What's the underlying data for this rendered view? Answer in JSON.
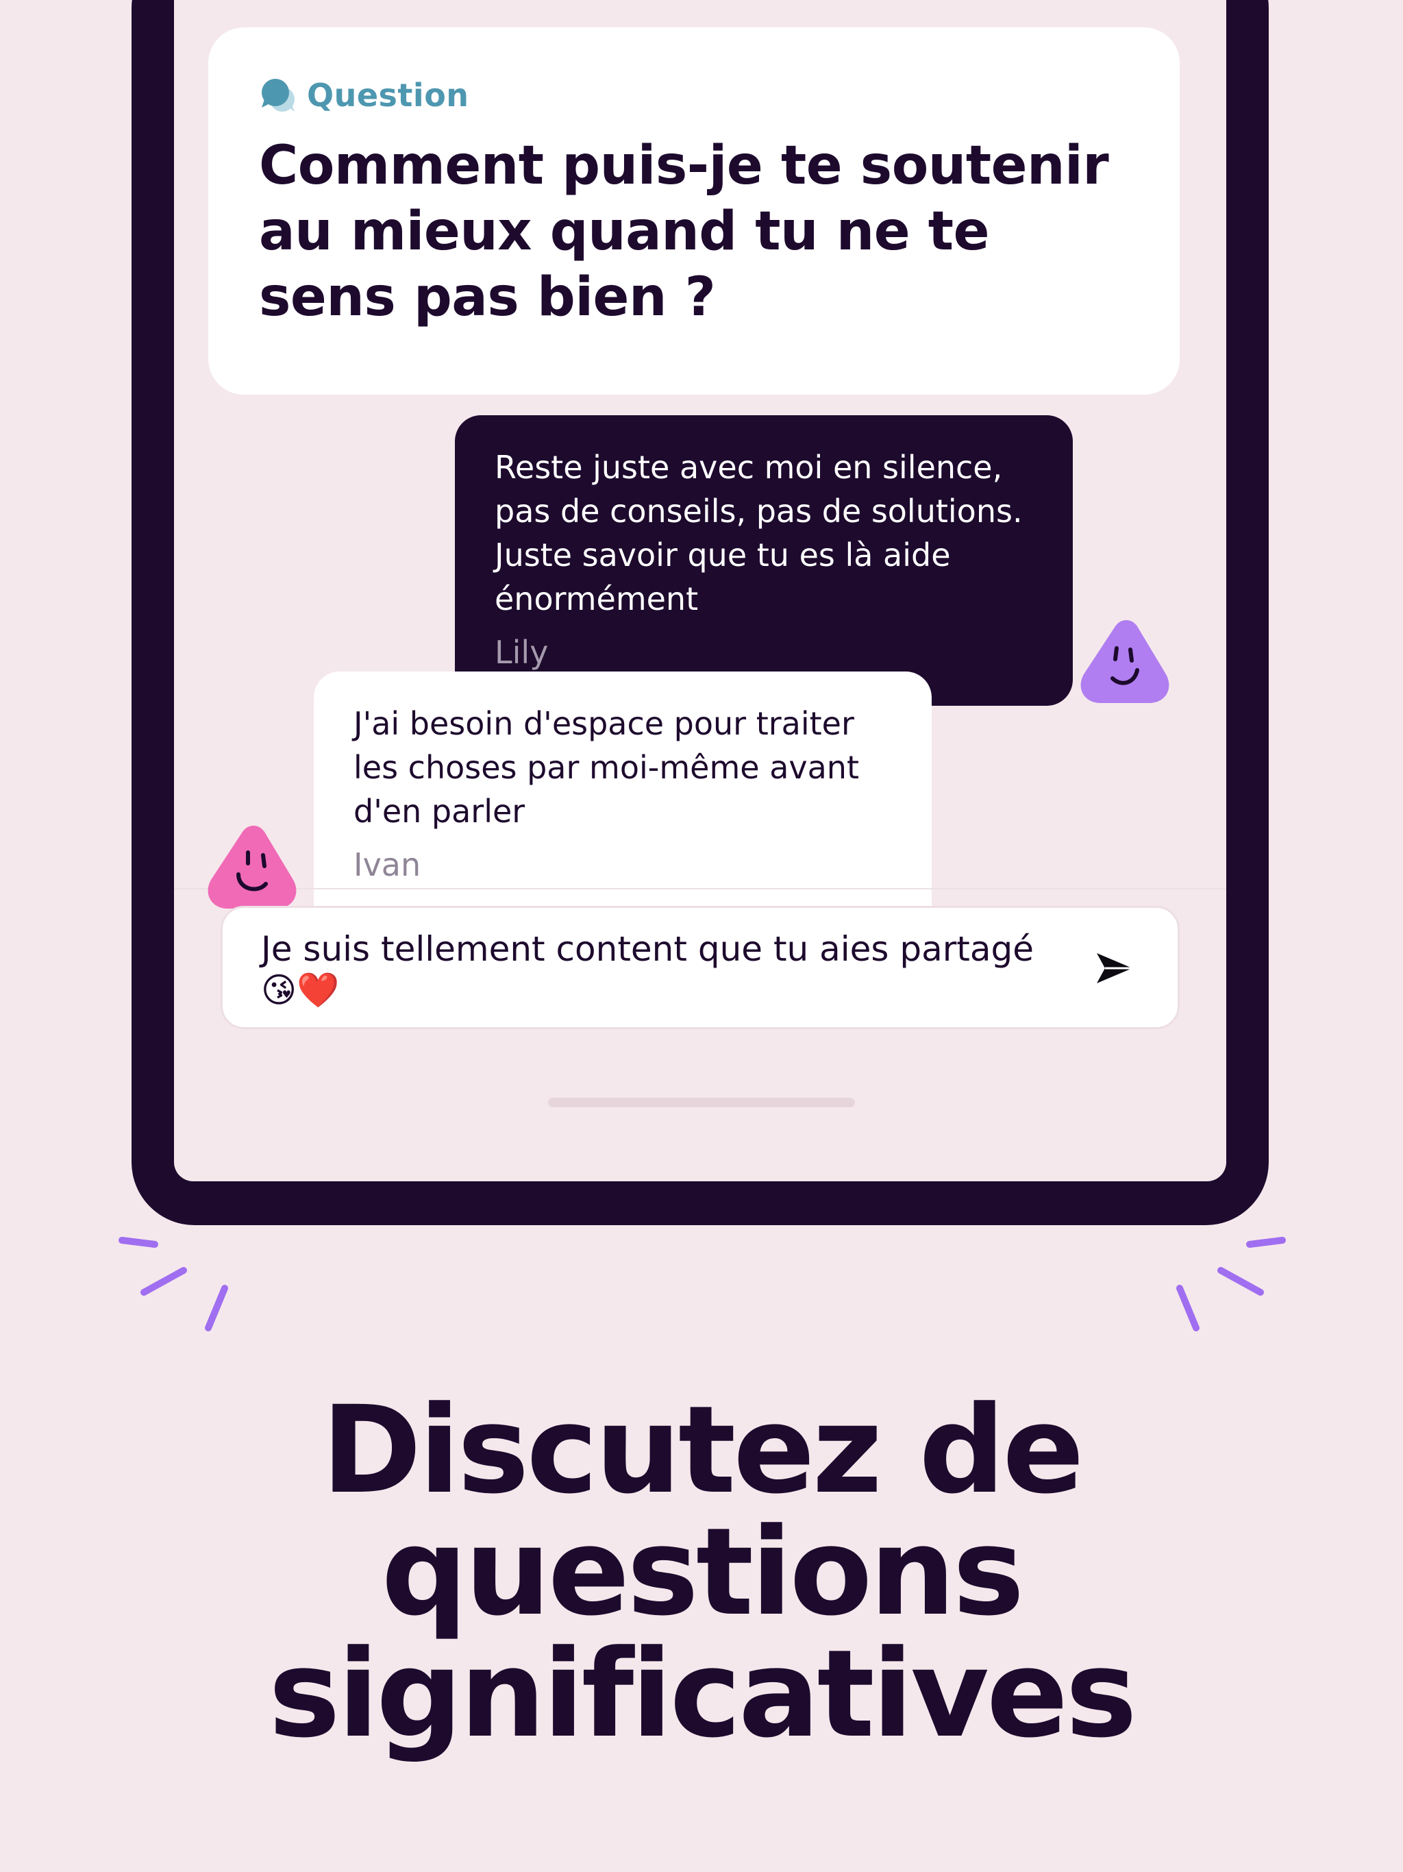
{
  "question": {
    "label": "Question",
    "icon": "speech-bubbles-icon",
    "text": "Comment puis-je te soutenir au mieux quand tu ne te sens pas bien ?"
  },
  "messages": [
    {
      "text": "Reste juste avec moi en silence, pas de conseils, pas de solutions. Juste savoir que tu es là aide énormément",
      "author": "Lily",
      "avatar_color": "#b07ef0"
    },
    {
      "text": "J'ai besoin d'espace pour traiter les choses par moi-même avant d'en parler",
      "author": "Ivan",
      "avatar_color": "#f06ab6"
    }
  ],
  "composer": {
    "value": "Je suis tellement content que tu aies partagé😘❤️",
    "send_icon": "send-arrow-icon"
  },
  "headline": "Discutez de questions significatives",
  "colors": {
    "background": "#f5e8ec",
    "ink": "#1d0a2d",
    "question_accent": "#4e97b0",
    "burst": "#a06ef0"
  }
}
